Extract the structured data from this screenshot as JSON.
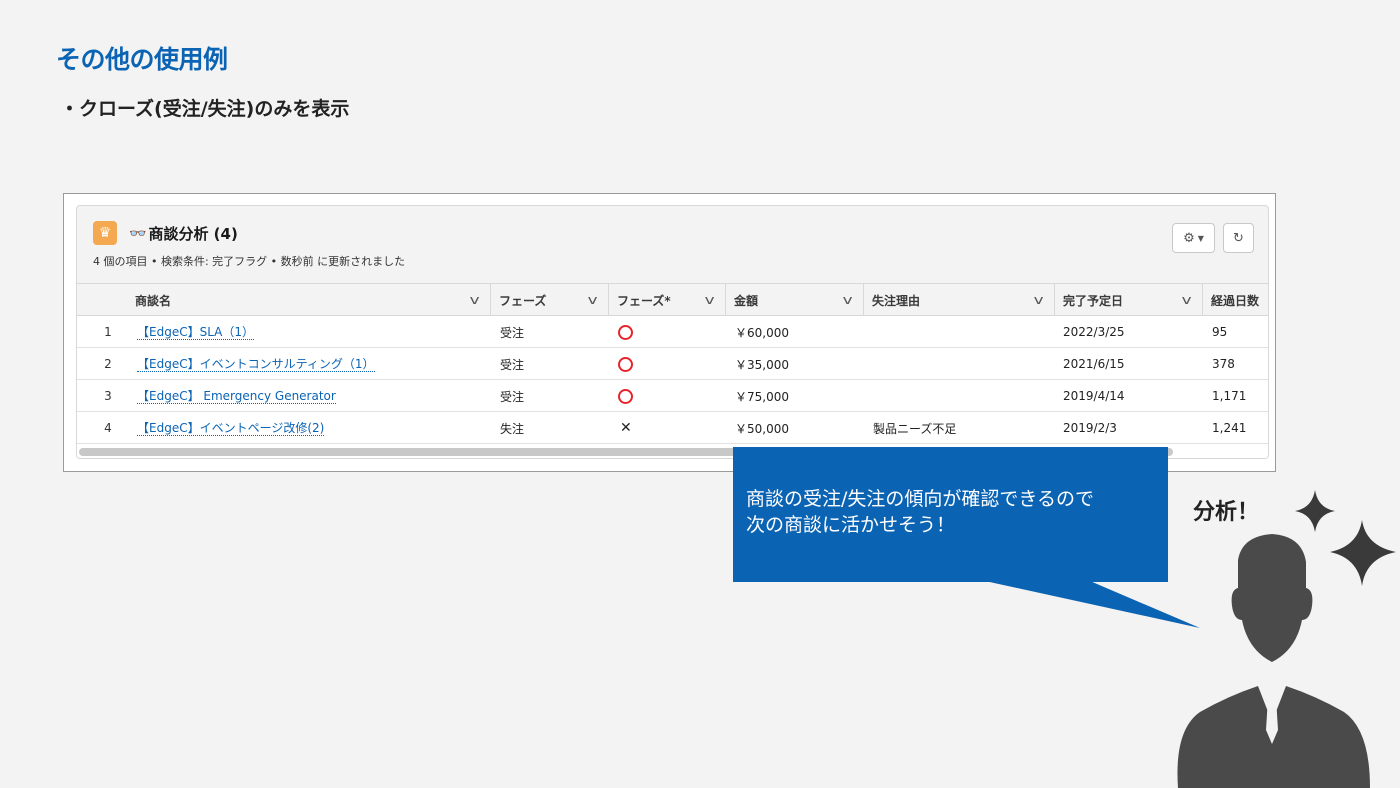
{
  "slide": {
    "title": "その他の使用例",
    "subtitle": "・クローズ(受注/失注)のみを表示"
  },
  "list_view": {
    "title": "商談分析 (4)",
    "meta": "4 個の項目 • 検索条件: 完了フラグ • 数秒前 に更新されました",
    "columns": [
      "商談名",
      "フェーズ",
      "フェーズ*",
      "金額",
      "失注理由",
      "完了予定日",
      "経過日数"
    ],
    "rows": [
      {
        "num": "1",
        "name": "【EdgeC】SLA（1）",
        "phase": "受注",
        "phase_mark": "circle",
        "amount": "￥60,000",
        "lost_reason": "",
        "close_date": "2022/3/25",
        "days": "95"
      },
      {
        "num": "2",
        "name": "【EdgeC】イベントコンサルティング（1）",
        "phase": "受注",
        "phase_mark": "circle",
        "amount": "￥35,000",
        "lost_reason": "",
        "close_date": "2021/6/15",
        "days": "378"
      },
      {
        "num": "3",
        "name": "【EdgeC】 Emergency Generator",
        "phase": "受注",
        "phase_mark": "circle",
        "amount": "￥75,000",
        "lost_reason": "",
        "close_date": "2019/4/14",
        "days": "1,171"
      },
      {
        "num": "4",
        "name": "【EdgeC】イベントページ改修(2)",
        "phase": "失注",
        "phase_mark": "cross",
        "amount": "￥50,000",
        "lost_reason": "製品ニーズ不足",
        "close_date": "2019/2/3",
        "days": "1,241"
      }
    ]
  },
  "callout": {
    "line1": "商談の受注/失注の傾向が確認できるので",
    "line2": "次の商談に活かせそう！"
  },
  "analysis_label": "分析！",
  "colors": {
    "accent": "#0b63b4",
    "circle_mark": "#e4262b",
    "icon_bg": "#f4a950",
    "person": "#4a4a4a"
  }
}
